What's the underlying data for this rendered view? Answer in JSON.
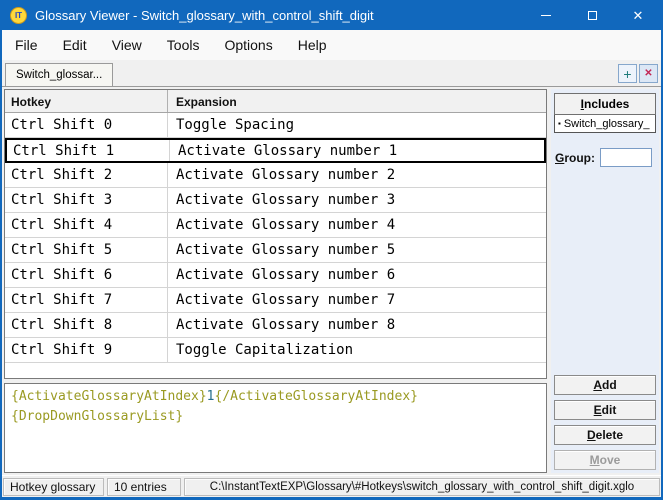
{
  "window": {
    "title": "Glossary Viewer - Switch_glossary_with_control_shift_digit",
    "icon_text": "IT"
  },
  "icons": {
    "close": "✕",
    "tab_close": "✕",
    "plus": "+",
    "bullet": "▪"
  },
  "menu": {
    "items": [
      "File",
      "Edit",
      "View",
      "Tools",
      "Options",
      "Help"
    ]
  },
  "tabs": {
    "active_label": "Switch_glossar..."
  },
  "table": {
    "columns": [
      "Hotkey",
      "Expansion"
    ],
    "selected_index": 1,
    "rows": [
      {
        "hotkey": "Ctrl Shift 0",
        "expansion": "Toggle Spacing"
      },
      {
        "hotkey": "Ctrl Shift 1",
        "expansion": "Activate Glossary number 1"
      },
      {
        "hotkey": "Ctrl Shift 2",
        "expansion": "Activate Glossary number 2"
      },
      {
        "hotkey": "Ctrl Shift 3",
        "expansion": "Activate Glossary number 3"
      },
      {
        "hotkey": "Ctrl Shift 4",
        "expansion": "Activate Glossary number 4"
      },
      {
        "hotkey": "Ctrl Shift 5",
        "expansion": "Activate Glossary number 5"
      },
      {
        "hotkey": "Ctrl Shift 6",
        "expansion": "Activate Glossary number 6"
      },
      {
        "hotkey": "Ctrl Shift 7",
        "expansion": "Activate Glossary number 7"
      },
      {
        "hotkey": "Ctrl Shift 8",
        "expansion": "Activate Glossary number 8"
      },
      {
        "hotkey": "Ctrl Shift 9",
        "expansion": "Toggle Capitalization"
      }
    ]
  },
  "side": {
    "includes": {
      "accel": "I",
      "rest": "ncludes"
    },
    "includes_item": "Switch_glossary_",
    "group": {
      "accel": "G",
      "rest": "roup:",
      "value": ""
    },
    "buttons": [
      {
        "name": "add-button",
        "accel": "A",
        "rest": "dd",
        "enabled": true
      },
      {
        "name": "edit-button",
        "accel": "E",
        "rest": "dit",
        "enabled": true
      },
      {
        "name": "delete-button",
        "accel": "D",
        "rest": "elete",
        "enabled": true
      },
      {
        "name": "move-button",
        "accel": "M",
        "rest": "ove",
        "enabled": false
      }
    ]
  },
  "editor": {
    "seg_open": "{ActivateGlossaryAtIndex}",
    "seg_value": "1",
    "seg_close": "{/ActivateGlossaryAtIndex}",
    "line2": "{DropDownGlossaryList}"
  },
  "statusbar": {
    "glossary_type": "Hotkey glossary",
    "entries": "10 entries",
    "path": "C:\\InstantTextEXP\\Glossary\\#Hotkeys\\switch_glossary_with_control_shift_digit.xglo"
  },
  "colors": {
    "titlebar": "#1168bd",
    "selection_border": "#000000",
    "code_command": "#9a9a22",
    "code_value": "#266e8c",
    "side_panel_bg": "#e8eef8"
  }
}
